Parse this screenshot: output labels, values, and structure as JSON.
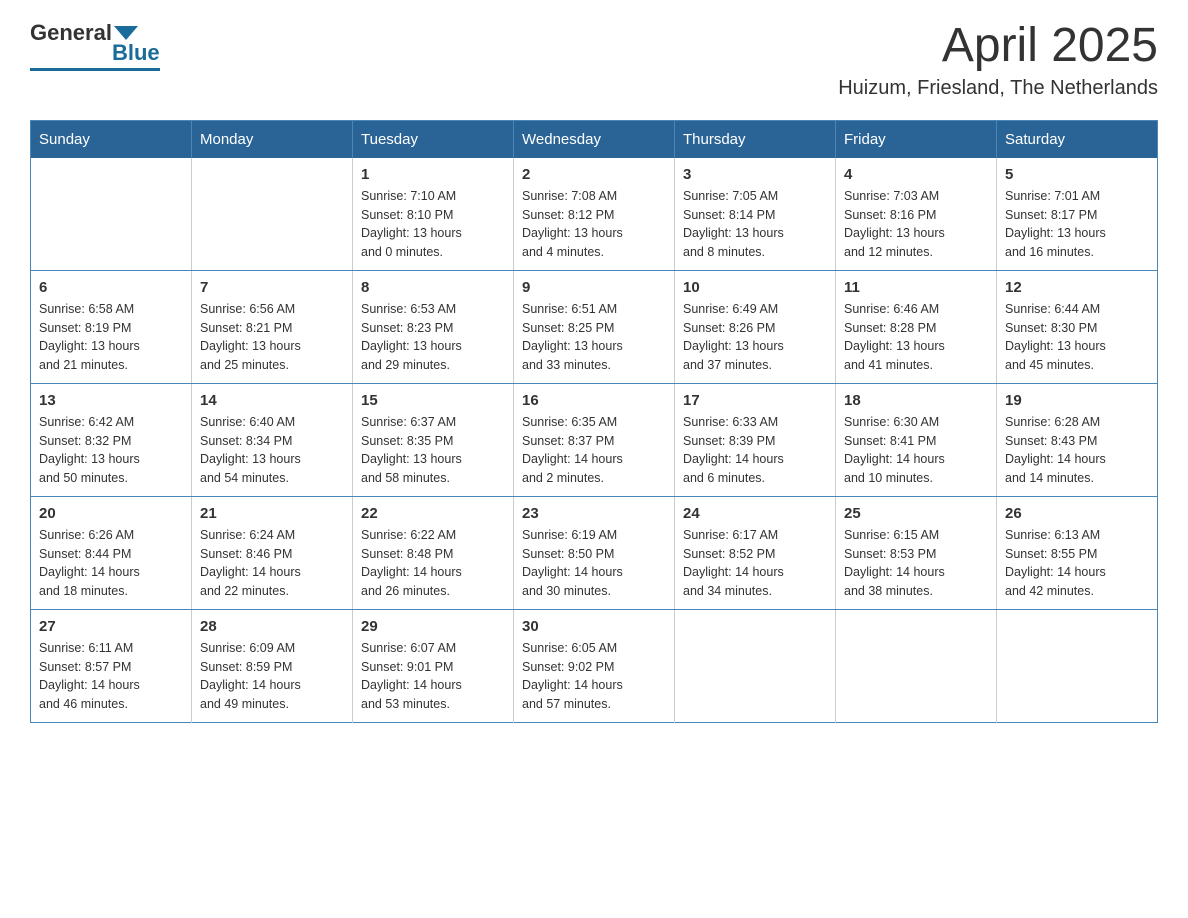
{
  "logo": {
    "general": "General",
    "blue": "Blue"
  },
  "header": {
    "title": "April 2025",
    "subtitle": "Huizum, Friesland, The Netherlands"
  },
  "weekdays": [
    "Sunday",
    "Monday",
    "Tuesday",
    "Wednesday",
    "Thursday",
    "Friday",
    "Saturday"
  ],
  "weeks": [
    [
      {
        "day": "",
        "info": ""
      },
      {
        "day": "",
        "info": ""
      },
      {
        "day": "1",
        "info": "Sunrise: 7:10 AM\nSunset: 8:10 PM\nDaylight: 13 hours\nand 0 minutes."
      },
      {
        "day": "2",
        "info": "Sunrise: 7:08 AM\nSunset: 8:12 PM\nDaylight: 13 hours\nand 4 minutes."
      },
      {
        "day": "3",
        "info": "Sunrise: 7:05 AM\nSunset: 8:14 PM\nDaylight: 13 hours\nand 8 minutes."
      },
      {
        "day": "4",
        "info": "Sunrise: 7:03 AM\nSunset: 8:16 PM\nDaylight: 13 hours\nand 12 minutes."
      },
      {
        "day": "5",
        "info": "Sunrise: 7:01 AM\nSunset: 8:17 PM\nDaylight: 13 hours\nand 16 minutes."
      }
    ],
    [
      {
        "day": "6",
        "info": "Sunrise: 6:58 AM\nSunset: 8:19 PM\nDaylight: 13 hours\nand 21 minutes."
      },
      {
        "day": "7",
        "info": "Sunrise: 6:56 AM\nSunset: 8:21 PM\nDaylight: 13 hours\nand 25 minutes."
      },
      {
        "day": "8",
        "info": "Sunrise: 6:53 AM\nSunset: 8:23 PM\nDaylight: 13 hours\nand 29 minutes."
      },
      {
        "day": "9",
        "info": "Sunrise: 6:51 AM\nSunset: 8:25 PM\nDaylight: 13 hours\nand 33 minutes."
      },
      {
        "day": "10",
        "info": "Sunrise: 6:49 AM\nSunset: 8:26 PM\nDaylight: 13 hours\nand 37 minutes."
      },
      {
        "day": "11",
        "info": "Sunrise: 6:46 AM\nSunset: 8:28 PM\nDaylight: 13 hours\nand 41 minutes."
      },
      {
        "day": "12",
        "info": "Sunrise: 6:44 AM\nSunset: 8:30 PM\nDaylight: 13 hours\nand 45 minutes."
      }
    ],
    [
      {
        "day": "13",
        "info": "Sunrise: 6:42 AM\nSunset: 8:32 PM\nDaylight: 13 hours\nand 50 minutes."
      },
      {
        "day": "14",
        "info": "Sunrise: 6:40 AM\nSunset: 8:34 PM\nDaylight: 13 hours\nand 54 minutes."
      },
      {
        "day": "15",
        "info": "Sunrise: 6:37 AM\nSunset: 8:35 PM\nDaylight: 13 hours\nand 58 minutes."
      },
      {
        "day": "16",
        "info": "Sunrise: 6:35 AM\nSunset: 8:37 PM\nDaylight: 14 hours\nand 2 minutes."
      },
      {
        "day": "17",
        "info": "Sunrise: 6:33 AM\nSunset: 8:39 PM\nDaylight: 14 hours\nand 6 minutes."
      },
      {
        "day": "18",
        "info": "Sunrise: 6:30 AM\nSunset: 8:41 PM\nDaylight: 14 hours\nand 10 minutes."
      },
      {
        "day": "19",
        "info": "Sunrise: 6:28 AM\nSunset: 8:43 PM\nDaylight: 14 hours\nand 14 minutes."
      }
    ],
    [
      {
        "day": "20",
        "info": "Sunrise: 6:26 AM\nSunset: 8:44 PM\nDaylight: 14 hours\nand 18 minutes."
      },
      {
        "day": "21",
        "info": "Sunrise: 6:24 AM\nSunset: 8:46 PM\nDaylight: 14 hours\nand 22 minutes."
      },
      {
        "day": "22",
        "info": "Sunrise: 6:22 AM\nSunset: 8:48 PM\nDaylight: 14 hours\nand 26 minutes."
      },
      {
        "day": "23",
        "info": "Sunrise: 6:19 AM\nSunset: 8:50 PM\nDaylight: 14 hours\nand 30 minutes."
      },
      {
        "day": "24",
        "info": "Sunrise: 6:17 AM\nSunset: 8:52 PM\nDaylight: 14 hours\nand 34 minutes."
      },
      {
        "day": "25",
        "info": "Sunrise: 6:15 AM\nSunset: 8:53 PM\nDaylight: 14 hours\nand 38 minutes."
      },
      {
        "day": "26",
        "info": "Sunrise: 6:13 AM\nSunset: 8:55 PM\nDaylight: 14 hours\nand 42 minutes."
      }
    ],
    [
      {
        "day": "27",
        "info": "Sunrise: 6:11 AM\nSunset: 8:57 PM\nDaylight: 14 hours\nand 46 minutes."
      },
      {
        "day": "28",
        "info": "Sunrise: 6:09 AM\nSunset: 8:59 PM\nDaylight: 14 hours\nand 49 minutes."
      },
      {
        "day": "29",
        "info": "Sunrise: 6:07 AM\nSunset: 9:01 PM\nDaylight: 14 hours\nand 53 minutes."
      },
      {
        "day": "30",
        "info": "Sunrise: 6:05 AM\nSunset: 9:02 PM\nDaylight: 14 hours\nand 57 minutes."
      },
      {
        "day": "",
        "info": ""
      },
      {
        "day": "",
        "info": ""
      },
      {
        "day": "",
        "info": ""
      }
    ]
  ]
}
